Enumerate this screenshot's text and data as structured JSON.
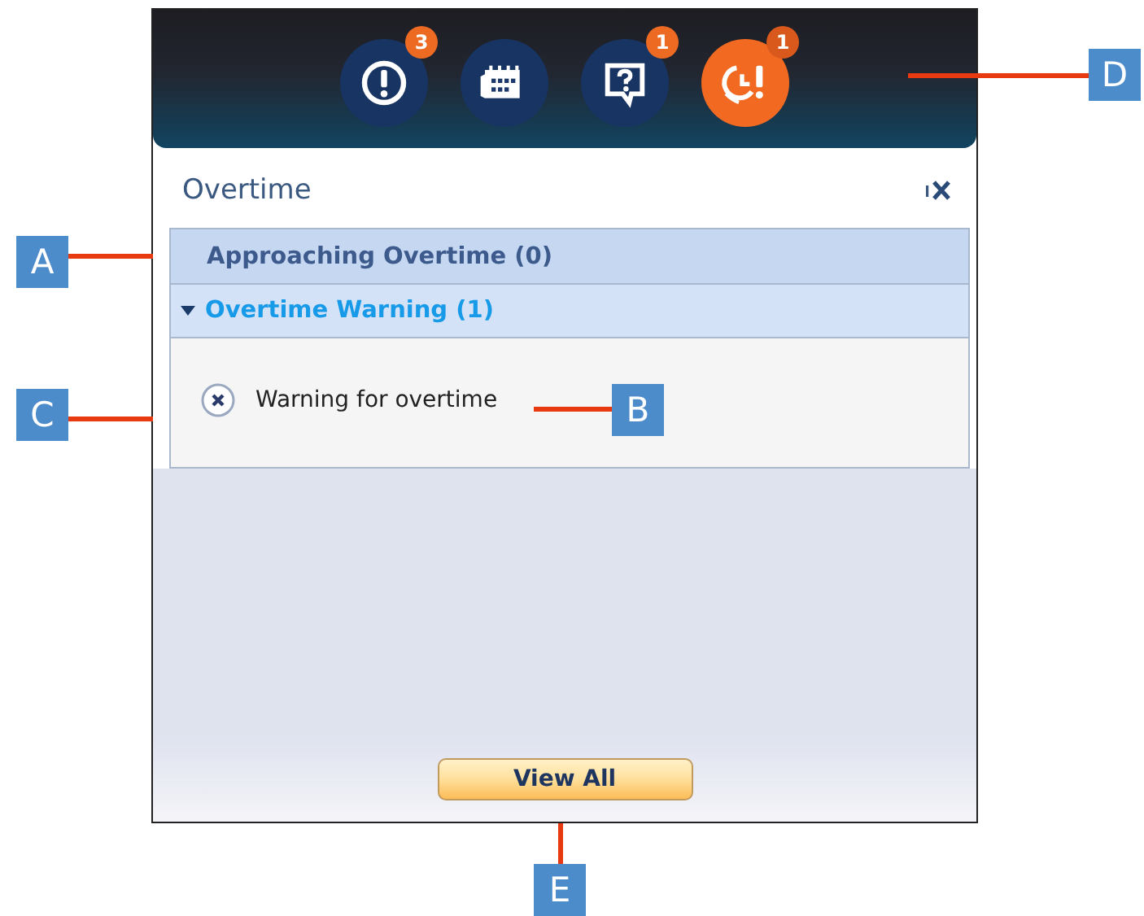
{
  "header": {
    "icons": [
      {
        "kind": "alert",
        "badge": "3",
        "selected": false
      },
      {
        "kind": "calendar",
        "selected": false
      },
      {
        "kind": "help",
        "badge": "1",
        "selected": false
      },
      {
        "kind": "overtime",
        "badge": "1",
        "selected": true
      }
    ]
  },
  "panel": {
    "title": "Overtime",
    "sections": [
      {
        "label": "Approaching Overtime (0)",
        "expanded": false
      },
      {
        "label": "Overtime Warning (1)",
        "expanded": true,
        "items": [
          "Warning for overtime"
        ]
      }
    ],
    "button": "View All"
  },
  "callouts": [
    {
      "label": "A"
    },
    {
      "label": "C"
    },
    {
      "label": "B"
    },
    {
      "label": "D"
    },
    {
      "label": "E"
    }
  ]
}
